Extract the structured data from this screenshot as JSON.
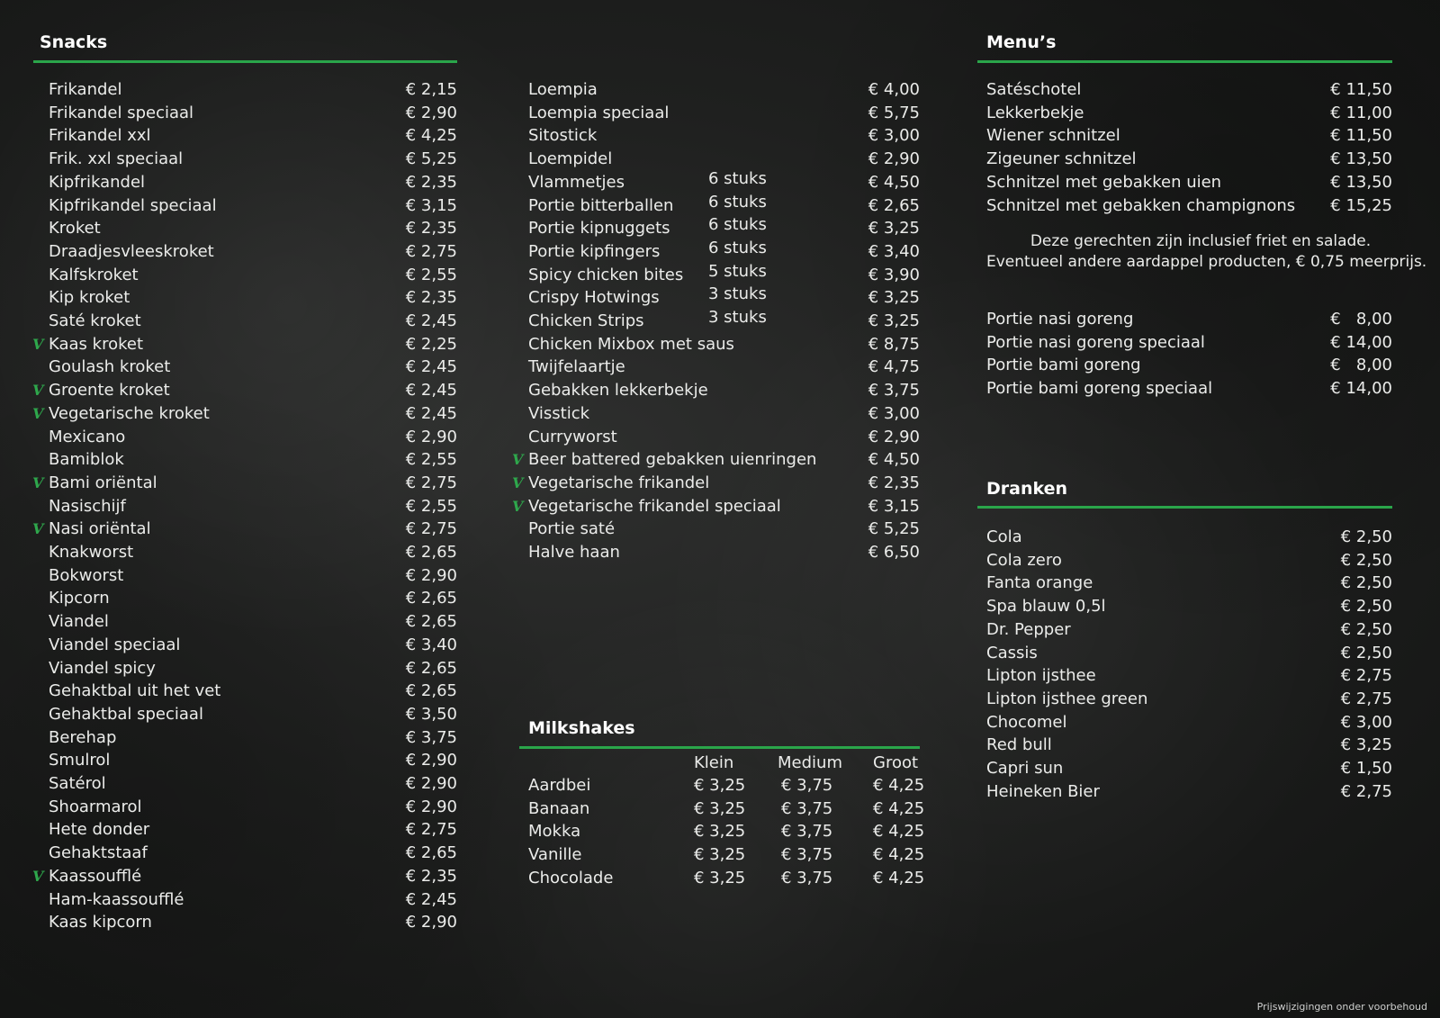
{
  "snacks": {
    "title": "Snacks",
    "items": [
      {
        "name": "Frikandel",
        "price": "€ 2,15",
        "veg": false
      },
      {
        "name": "Frikandel speciaal",
        "price": "€ 2,90",
        "veg": false
      },
      {
        "name": "Frikandel xxl",
        "price": "€ 4,25",
        "veg": false
      },
      {
        "name": "Frik. xxl speciaal",
        "price": "€ 5,25",
        "veg": false
      },
      {
        "name": "Kipfrikandel",
        "price": "€ 2,35",
        "veg": false
      },
      {
        "name": "Kipfrikandel speciaal",
        "price": "€ 3,15",
        "veg": false
      },
      {
        "name": "Kroket",
        "price": "€ 2,35",
        "veg": false
      },
      {
        "name": "Draadjesvleeskroket",
        "price": "€ 2,75",
        "veg": false
      },
      {
        "name": "Kalfskroket",
        "price": "€ 2,55",
        "veg": false
      },
      {
        "name": "Kip kroket",
        "price": "€ 2,35",
        "veg": false
      },
      {
        "name": "Saté kroket",
        "price": "€ 2,45",
        "veg": false
      },
      {
        "name": "Kaas kroket",
        "price": "€ 2,25",
        "veg": true
      },
      {
        "name": "Goulash kroket",
        "price": "€ 2,45",
        "veg": false
      },
      {
        "name": "Groente kroket",
        "price": "€ 2,45",
        "veg": true
      },
      {
        "name": "Vegetarische kroket",
        "price": "€ 2,45",
        "veg": true
      },
      {
        "name": "Mexicano",
        "price": "€ 2,90",
        "veg": false
      },
      {
        "name": "Bamiblok",
        "price": "€ 2,55",
        "veg": false
      },
      {
        "name": "Bami oriëntal",
        "price": "€ 2,75",
        "veg": true
      },
      {
        "name": "Nasischijf",
        "price": "€ 2,55",
        "veg": false
      },
      {
        "name": "Nasi oriëntal",
        "price": "€ 2,75",
        "veg": true
      },
      {
        "name": "Knakworst",
        "price": "€ 2,65",
        "veg": false
      },
      {
        "name": "Bokworst",
        "price": "€ 2,90",
        "veg": false
      },
      {
        "name": "Kipcorn",
        "price": "€ 2,65",
        "veg": false
      },
      {
        "name": "Viandel",
        "price": "€ 2,65",
        "veg": false
      },
      {
        "name": "Viandel speciaal",
        "price": "€ 3,40",
        "veg": false
      },
      {
        "name": "Viandel spicy",
        "price": "€ 2,65",
        "veg": false
      },
      {
        "name": "Gehaktbal uit het vet",
        "price": "€ 2,65",
        "veg": false
      },
      {
        "name": "Gehaktbal speciaal",
        "price": "€ 3,50",
        "veg": false
      },
      {
        "name": "Berehap",
        "price": "€ 3,75",
        "veg": false
      },
      {
        "name": "Smulrol",
        "price": "€ 2,90",
        "veg": false
      },
      {
        "name": "Satérol",
        "price": "€ 2,90",
        "veg": false
      },
      {
        "name": "Shoarmarol",
        "price": "€ 2,90",
        "veg": false
      },
      {
        "name": "Hete donder",
        "price": "€ 2,75",
        "veg": false
      },
      {
        "name": "Gehaktstaaf",
        "price": "€ 2,65",
        "veg": false
      },
      {
        "name": "Kaassoufflé",
        "price": "€ 2,35",
        "veg": true
      },
      {
        "name": "Ham-kaassoufflé",
        "price": "€ 2,45",
        "veg": false
      },
      {
        "name": "Kaas kipcorn",
        "price": "€ 2,90",
        "veg": false
      }
    ]
  },
  "middle": {
    "items": [
      {
        "name": "Loempia",
        "qty": "",
        "price": "€ 4,00",
        "veg": false
      },
      {
        "name": "Loempia speciaal",
        "qty": "",
        "price": "€ 5,75",
        "veg": false
      },
      {
        "name": "Sitostick",
        "qty": "",
        "price": "€ 3,00",
        "veg": false
      },
      {
        "name": "Loempidel",
        "qty": "",
        "price": "€ 2,90",
        "veg": false
      },
      {
        "name": "Vlammetjes",
        "qty": "6 stuks",
        "price": "€ 4,50",
        "veg": false
      },
      {
        "name": "Portie bitterballen",
        "qty": "6 stuks",
        "price": "€ 2,65",
        "veg": false
      },
      {
        "name": "Portie kipnuggets",
        "qty": "6 stuks",
        "price": "€ 3,25",
        "veg": false
      },
      {
        "name": "Portie kipfingers",
        "qty": "6 stuks",
        "price": "€ 3,40",
        "veg": false
      },
      {
        "name": "Spicy chicken bites",
        "qty": "5 stuks",
        "price": "€ 3,90",
        "veg": false
      },
      {
        "name": "Crispy Hotwings",
        "qty": "3 stuks",
        "price": "€ 3,25",
        "veg": false
      },
      {
        "name": "Chicken Strips",
        "qty": "3 stuks",
        "price": "€ 3,25",
        "veg": false
      },
      {
        "name": "Chicken Mixbox met saus",
        "qty": "",
        "price": "€ 8,75",
        "veg": false
      },
      {
        "name": "Twijfelaartje",
        "qty": "",
        "price": "€ 4,75",
        "veg": false
      },
      {
        "name": "Gebakken lekkerbekje",
        "qty": "",
        "price": "€ 3,75",
        "veg": false
      },
      {
        "name": "Visstick",
        "qty": "",
        "price": "€ 3,00",
        "veg": false
      },
      {
        "name": "Curryworst",
        "qty": "",
        "price": "€ 2,90",
        "veg": false
      },
      {
        "name": "Beer battered gebakken uienringen",
        "qty": "",
        "price": "€ 4,50",
        "veg": true
      },
      {
        "name": "Vegetarische frikandel",
        "qty": "",
        "price": "€ 2,35",
        "veg": true
      },
      {
        "name": "Vegetarische frikandel speciaal",
        "qty": "",
        "price": "€ 3,15",
        "veg": true
      },
      {
        "name": "Portie saté",
        "qty": "",
        "price": "€ 5,25",
        "veg": false
      },
      {
        "name": "Halve haan",
        "qty": "",
        "price": "€ 6,50",
        "veg": false
      }
    ]
  },
  "milkshakes": {
    "title": "Milkshakes",
    "sizes": [
      "Klein",
      "Medium",
      "Groot"
    ],
    "items": [
      {
        "name": "Aardbei",
        "prices": [
          "€ 3,25",
          "€ 3,75",
          "€ 4,25"
        ]
      },
      {
        "name": "Banaan",
        "prices": [
          "€ 3,25",
          "€ 3,75",
          "€ 4,25"
        ]
      },
      {
        "name": "Mokka",
        "prices": [
          "€ 3,25",
          "€ 3,75",
          "€ 4,25"
        ]
      },
      {
        "name": "Vanille",
        "prices": [
          "€ 3,25",
          "€ 3,75",
          "€ 4,25"
        ]
      },
      {
        "name": "Chocolade",
        "prices": [
          "€ 3,25",
          "€ 3,75",
          "€ 4,25"
        ]
      }
    ]
  },
  "menus": {
    "title": "Menu’s",
    "items": [
      {
        "name": "Satéschotel",
        "price": "€ 11,50"
      },
      {
        "name": "Lekkerbekje",
        "price": "€ 11,00"
      },
      {
        "name": "Wiener schnitzel",
        "price": "€ 11,50"
      },
      {
        "name": "Zigeuner schnitzel",
        "price": "€ 13,50"
      },
      {
        "name": "Schnitzel met gebakken uien",
        "price": "€ 13,50"
      },
      {
        "name": "Schnitzel met gebakken champignons",
        "price": "€ 15,25"
      }
    ],
    "note_line1": "Deze gerechten zijn inclusief friet en salade.",
    "note_line2": "Eventueel andere aardappel producten, € 0,75 meerprijs.",
    "portions": [
      {
        "name": "Portie nasi goreng",
        "price": "€   8,00"
      },
      {
        "name": "Portie nasi goreng speciaal",
        "price": "€ 14,00"
      },
      {
        "name": "Portie bami goreng",
        "price": "€   8,00"
      },
      {
        "name": "Portie bami goreng speciaal",
        "price": "€ 14,00"
      }
    ]
  },
  "dranken": {
    "title": "Dranken",
    "items": [
      {
        "name": "Cola",
        "price": "€ 2,50"
      },
      {
        "name": "Cola zero",
        "price": "€ 2,50"
      },
      {
        "name": "Fanta orange",
        "price": "€ 2,50"
      },
      {
        "name": "Spa blauw 0,5l",
        "price": "€ 2,50"
      },
      {
        "name": "Dr. Pepper",
        "price": "€ 2,50"
      },
      {
        "name": "Cassis",
        "price": "€ 2,50"
      },
      {
        "name": "Lipton ijsthee",
        "price": "€ 2,75"
      },
      {
        "name": "Lipton ijsthee green",
        "price": "€ 2,75"
      },
      {
        "name": "Chocomel",
        "price": "€ 3,00"
      },
      {
        "name": "Red bull",
        "price": "€ 3,25"
      },
      {
        "name": "Capri sun",
        "price": "€ 1,50"
      },
      {
        "name": "Heineken Bier",
        "price": "€ 2,75"
      }
    ]
  },
  "veg_mark": "V",
  "footer": "Prijswijzigingen onder voorbehoud",
  "colors": {
    "accent": "#2aa54a",
    "background": "#1f201f",
    "text": "#ebecea"
  }
}
